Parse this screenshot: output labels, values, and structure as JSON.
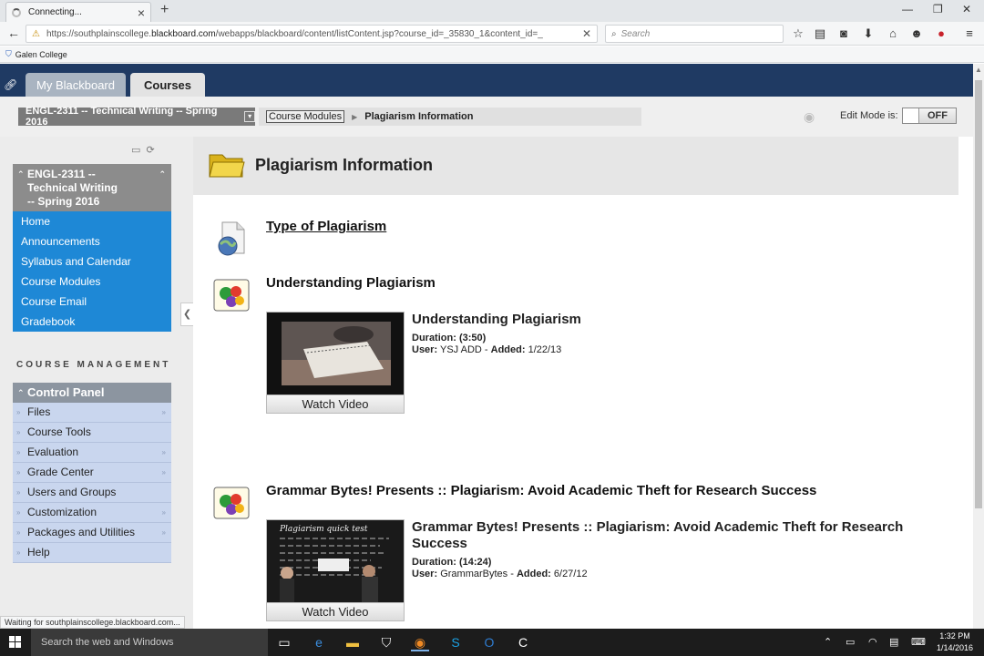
{
  "browser": {
    "tab_title": "Connecting...",
    "tab_close": "×",
    "new_tab": "+",
    "url_prefix": "https://southplainscollege.",
    "url_domain": "blackboard.com",
    "url_path": "/webapps/blackboard/content/listContent.jsp?course_id=_35830_1&content_id=_",
    "search_placeholder": "Search",
    "bookmark": "Galen College",
    "status_text": "Waiting for southplainscollege.blackboard.com..."
  },
  "header": {
    "tab_myblackboard": "My Blackboard",
    "tab_courses": "Courses"
  },
  "breadcrumb": {
    "course_select": "ENGL-2311 -- Technical Writing -- Spring 2016",
    "crumb_link": "Course Modules",
    "current": "Plagiarism Information",
    "edit_mode_label": "Edit Mode is:",
    "edit_mode_value": "OFF"
  },
  "course_menu": {
    "title_line1": "ENGL-2311 --",
    "title_line2": "Technical Writing",
    "title_line3": "-- Spring 2016",
    "items": [
      {
        "label": "Home"
      },
      {
        "label": "Announcements"
      },
      {
        "label": "Syllabus and Calendar"
      },
      {
        "label": "Course Modules"
      },
      {
        "label": "Course Email"
      },
      {
        "label": "Gradebook"
      }
    ]
  },
  "course_management": {
    "heading": "COURSE MANAGEMENT",
    "control_panel": "Control Panel",
    "items": [
      {
        "label": "Files",
        "has_arrow": true
      },
      {
        "label": "Course Tools",
        "has_arrow": false
      },
      {
        "label": "Evaluation",
        "has_arrow": true
      },
      {
        "label": "Grade Center",
        "has_arrow": true
      },
      {
        "label": "Users and Groups",
        "has_arrow": false
      },
      {
        "label": "Customization",
        "has_arrow": true
      },
      {
        "label": "Packages and Utilities",
        "has_arrow": true
      },
      {
        "label": "Help",
        "has_arrow": false
      }
    ]
  },
  "content": {
    "page_title": "Plagiarism Information",
    "items": [
      {
        "title": "Type of Plagiarism",
        "icon": "web-link-icon"
      },
      {
        "title": "Understanding Plagiarism",
        "icon": "mashup-icon",
        "video_title": "Understanding Plagiarism",
        "duration_label": "Duration:",
        "duration": "(3:50)",
        "user_label": "User:",
        "user": "YSJ ADD",
        "added_label": "Added:",
        "added": "1/22/13",
        "watch": "Watch Video"
      },
      {
        "title": "Grammar Bytes! Presents :: Plagiarism: Avoid Academic Theft for Research Success",
        "icon": "mashup-icon",
        "video_title_line1": "Grammar Bytes! Presents :: Plagiarism: Avoid Academic Theft for Research",
        "video_title_line2": "Success",
        "duration_label": "Duration:",
        "duration": "(14:24)",
        "user_label": "User:",
        "user": "GrammarBytes",
        "added_label": "Added:",
        "added": "6/27/12",
        "watch": "Watch Video",
        "thumb_text": "Plagiarism quick test"
      }
    ]
  },
  "taskbar": {
    "search": "Search the web and Windows",
    "time": "1:32 PM",
    "date": "1/14/2016"
  }
}
